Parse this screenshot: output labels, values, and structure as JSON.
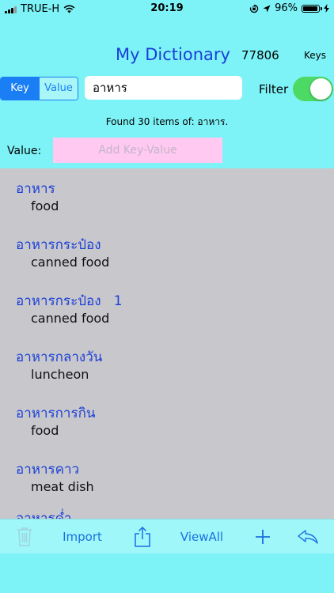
{
  "status_bar": {
    "carrier": "TRUE-H",
    "time": "20:19",
    "battery_percent": "96%",
    "battery_level": 0.96,
    "icons": [
      "signal-icon",
      "wifi-icon",
      "orientation-lock-icon",
      "location-icon",
      "battery-icon",
      "charging-icon"
    ]
  },
  "header": {
    "title": "My Dictionary",
    "key_count": "77806",
    "keys_label": "Keys"
  },
  "search": {
    "mode_options": [
      "Key",
      "Value"
    ],
    "mode_selected": "Key",
    "query": "อาหาร",
    "filter_label": "Filter",
    "filter_on": true
  },
  "result_message": "Found 30 items of: อาหาร.",
  "value_entry": {
    "label": "Value:",
    "placeholder": "Add Key-Value"
  },
  "entries": [
    {
      "key": "อาหาร",
      "value": "food"
    },
    {
      "key": "อาหารกระป๋อง",
      "value": "canned food"
    },
    {
      "key": "อาหารกระป๋อง   1",
      "value": "canned food"
    },
    {
      "key": "อาหารกลางวัน",
      "value": "luncheon"
    },
    {
      "key": "อาหารการกิน",
      "value": "food"
    },
    {
      "key": "อาหารคาว",
      "value": "meat dish"
    },
    {
      "key": "อาหารค่ำ",
      "value": ""
    }
  ],
  "toolbar": {
    "import_label": "Import",
    "viewall_label": "ViewAll"
  },
  "colors": {
    "background": "#7ef3f7",
    "accent_blue": "#1a7ef5",
    "title_blue": "#1b3fd6",
    "toggle_on": "#4cd964",
    "value_field_pink": "#ffc9f2",
    "list_gray": "#c7c7cc"
  }
}
